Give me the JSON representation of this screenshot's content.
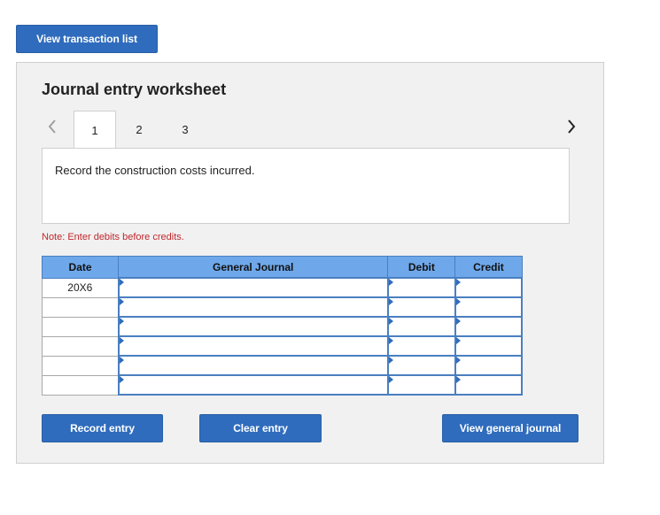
{
  "top_button": {
    "label": "View transaction list"
  },
  "worksheet": {
    "title": "Journal entry worksheet",
    "tabs": [
      {
        "label": "1",
        "active": true
      },
      {
        "label": "2",
        "active": false
      },
      {
        "label": "3",
        "active": false
      }
    ],
    "instruction": "Record the construction costs incurred.",
    "note": "Note: Enter debits before credits.",
    "table": {
      "headers": {
        "date": "Date",
        "general_journal": "General Journal",
        "debit": "Debit",
        "credit": "Credit"
      },
      "rows": [
        {
          "date": "20X6",
          "account": "",
          "debit": "",
          "credit": ""
        },
        {
          "date": "",
          "account": "",
          "debit": "",
          "credit": ""
        },
        {
          "date": "",
          "account": "",
          "debit": "",
          "credit": ""
        },
        {
          "date": "",
          "account": "",
          "debit": "",
          "credit": ""
        },
        {
          "date": "",
          "account": "",
          "debit": "",
          "credit": ""
        },
        {
          "date": "",
          "account": "",
          "debit": "",
          "credit": ""
        }
      ]
    },
    "buttons": {
      "record": "Record entry",
      "clear": "Clear entry",
      "view_journal": "View general journal"
    }
  },
  "colors": {
    "button_blue": "#2f6cbd",
    "table_header": "#6ea8ea",
    "note_red": "#c0282d",
    "panel_bg": "#f1f1f1"
  },
  "icons": {
    "prev": "chevron-left-icon",
    "next": "chevron-right-icon",
    "cell_marker": "triangle-right-icon"
  }
}
